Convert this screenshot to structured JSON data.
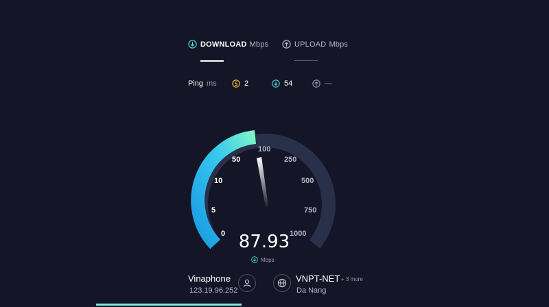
{
  "tabs": {
    "download": {
      "label": "DOWNLOAD",
      "unit": "Mbps",
      "icon": "download-arrow-icon",
      "active": true
    },
    "upload": {
      "label": "UPLOAD",
      "unit": "Mbps",
      "icon": "upload-arrow-icon",
      "active": false
    }
  },
  "ping": {
    "label": "Ping",
    "unit": "ms",
    "jitter": {
      "icon": "idle-ping-icon",
      "value": "2"
    },
    "download": {
      "icon": "download-arrow-icon",
      "value": "54"
    },
    "upload": {
      "icon": "upload-arrow-icon",
      "value": "—"
    }
  },
  "gauge": {
    "ticks": [
      "0",
      "5",
      "10",
      "50",
      "100",
      "250",
      "500",
      "750",
      "1000"
    ],
    "value": "87.93",
    "unit": "Mbps",
    "colors": {
      "fill_start": "#21a7e6",
      "fill_end": "#7ef5c9",
      "track": "#28304a",
      "needle": "#ffffff"
    }
  },
  "connection": {
    "isp": "Vinaphone",
    "ip": "123.19.96.252",
    "server": "VNPT-NET",
    "server_more": "+ 3 more",
    "location": "Da Nang"
  },
  "colors": {
    "background": "#141526",
    "accent": "#4fd9d0"
  }
}
